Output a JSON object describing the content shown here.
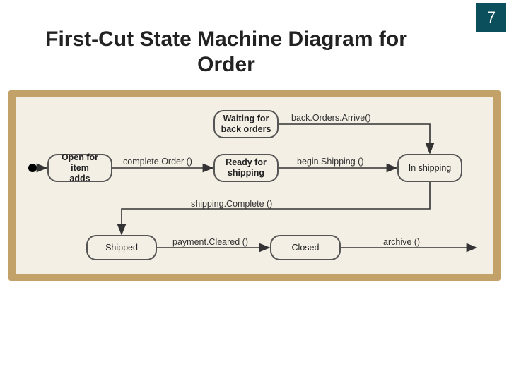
{
  "page_number": "7",
  "title": "First-Cut State Machine Diagram for Order",
  "states": {
    "open": "Open for item\nadds",
    "waiting": "Waiting for\nback orders",
    "ready": "Ready for\nshipping",
    "inship": "In shipping",
    "shipped": "Shipped",
    "closed": "Closed"
  },
  "transitions": {
    "complete_order": "complete.Order ()",
    "back_orders": "back.Orders.Arrive()",
    "begin_shipping": "begin.Shipping ()",
    "shipping_complete": "shipping.Complete ()",
    "payment_cleared": "payment.Cleared ()",
    "archive": "archive ()"
  }
}
